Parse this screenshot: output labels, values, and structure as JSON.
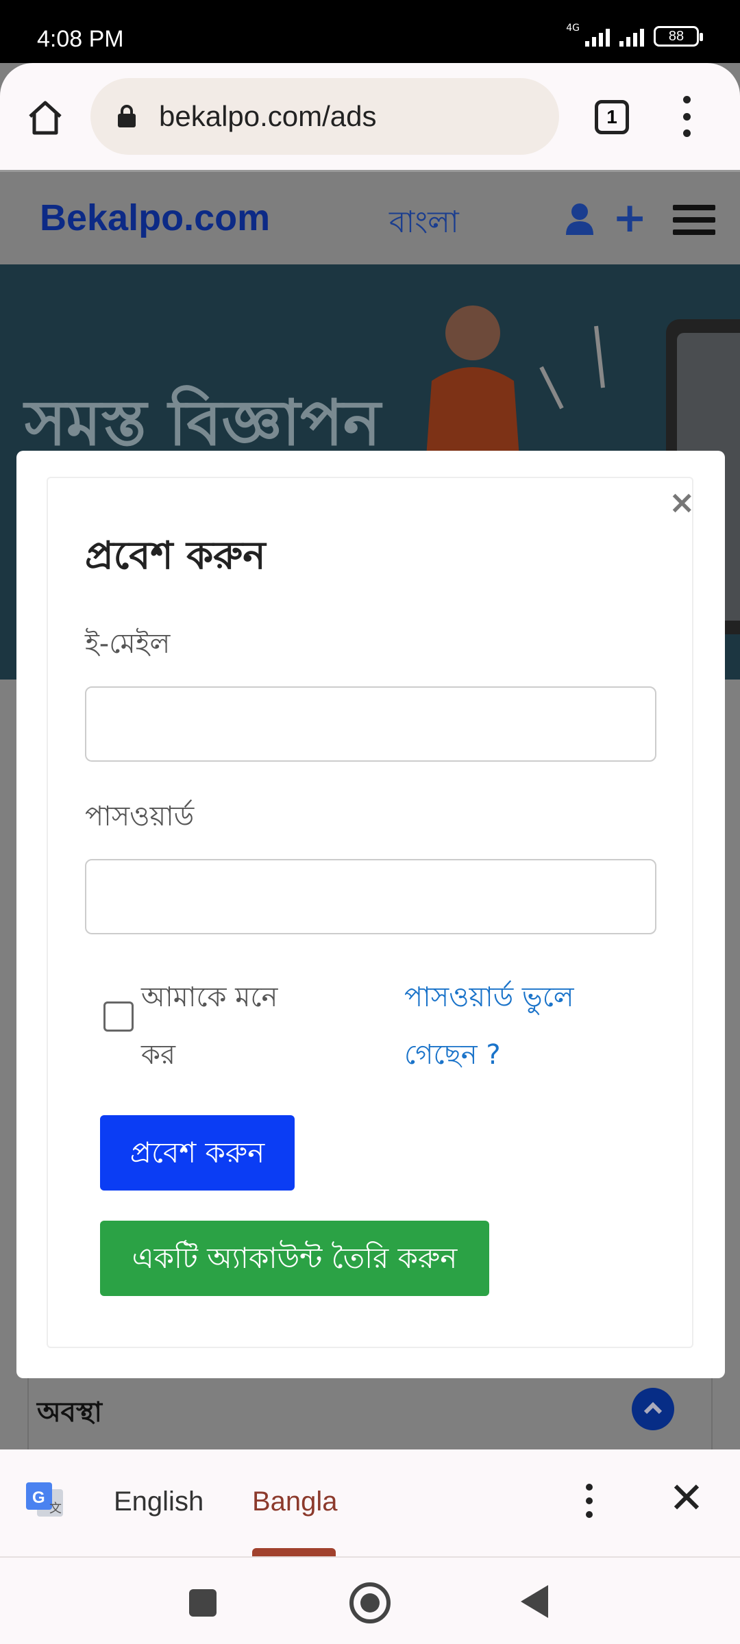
{
  "status_bar": {
    "time": "4:08 PM",
    "network": "4G",
    "battery": "88"
  },
  "browser": {
    "url": "bekalpo.com/ads",
    "tab_count": "1"
  },
  "site": {
    "logo": "Bekalpo.com",
    "language_link": "বাংলা"
  },
  "hero": {
    "title": "সমস্ত বিজ্ঞাপন"
  },
  "section": {
    "title": "অবস্থা"
  },
  "modal": {
    "close": "×",
    "title": "প্রবেশ করুন",
    "email_label": "ই-মেইল",
    "email_value": "",
    "password_label": "পাসওয়ার্ড",
    "password_value": "",
    "remember_label": "আমাকে মনে কর",
    "remember_checked": false,
    "forgot_link": "পাসওয়ার্ড ভুলে গেছেন ?",
    "login_button": "প্রবেশ করুন",
    "create_button": "একটি অ্যাকাউন্ট তৈরি করুন"
  },
  "translate_bar": {
    "lang_source": "English",
    "lang_target": "Bangla",
    "close": "✕"
  },
  "colors": {
    "login_button": "#0b3df4",
    "create_button": "#2ba245",
    "link": "#1a73c9",
    "logo": "#0c2a86"
  }
}
